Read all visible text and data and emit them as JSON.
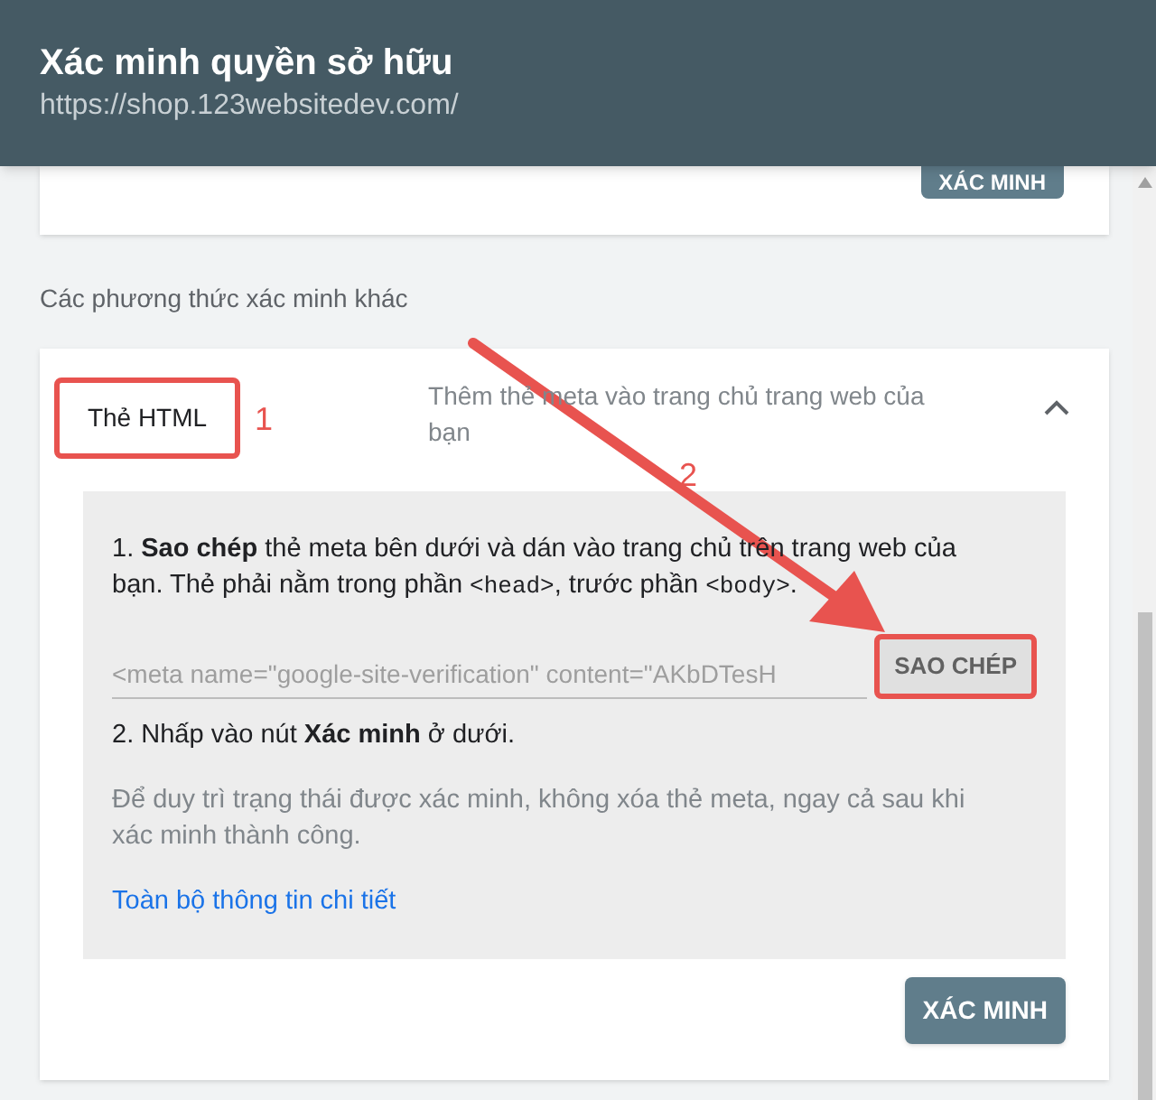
{
  "header": {
    "title": "Xác minh quyền sở hữu",
    "subtitle": "https://shop.123websitedev.com/"
  },
  "top_card": {
    "button": "XÁC MINH"
  },
  "section_label": "Các phương thức xác minh khác",
  "method": {
    "name": "Thẻ HTML",
    "name_highlighted": true,
    "description": "Thêm thẻ meta vào trang chủ trang web của bạn",
    "expanded": true,
    "step1": [
      {
        "kind": "text",
        "text": "1. **Sao chép** thẻ meta bên dưới và dán vào trang chủ trên trang web của bạn. Thẻ phải nằm trong phần "
      },
      {
        "kind": "code",
        "text": "<head>"
      },
      {
        "kind": "text",
        "text": ", trước phần "
      },
      {
        "kind": "code",
        "text": "<body>"
      },
      {
        "kind": "text",
        "text": "."
      }
    ],
    "meta_value": "<meta name=\"google-site-verification\" content=\"AKbDTesH",
    "copy_button": "SAO CHÉP",
    "copy_highlighted": true,
    "step2": "2. Nhấp vào nút **Xác minh** ở dưới.",
    "note": "Để duy trì trạng thái được xác minh, không xóa thẻ meta, ngay cả sau khi xác minh thành công.",
    "link": "Toàn bộ thông tin chi tiết",
    "verify_button": "XÁC MINH"
  },
  "annotations": [
    {
      "kind": "number",
      "text": "1"
    },
    {
      "kind": "number",
      "text": "2"
    },
    {
      "kind": "arrow"
    }
  ]
}
